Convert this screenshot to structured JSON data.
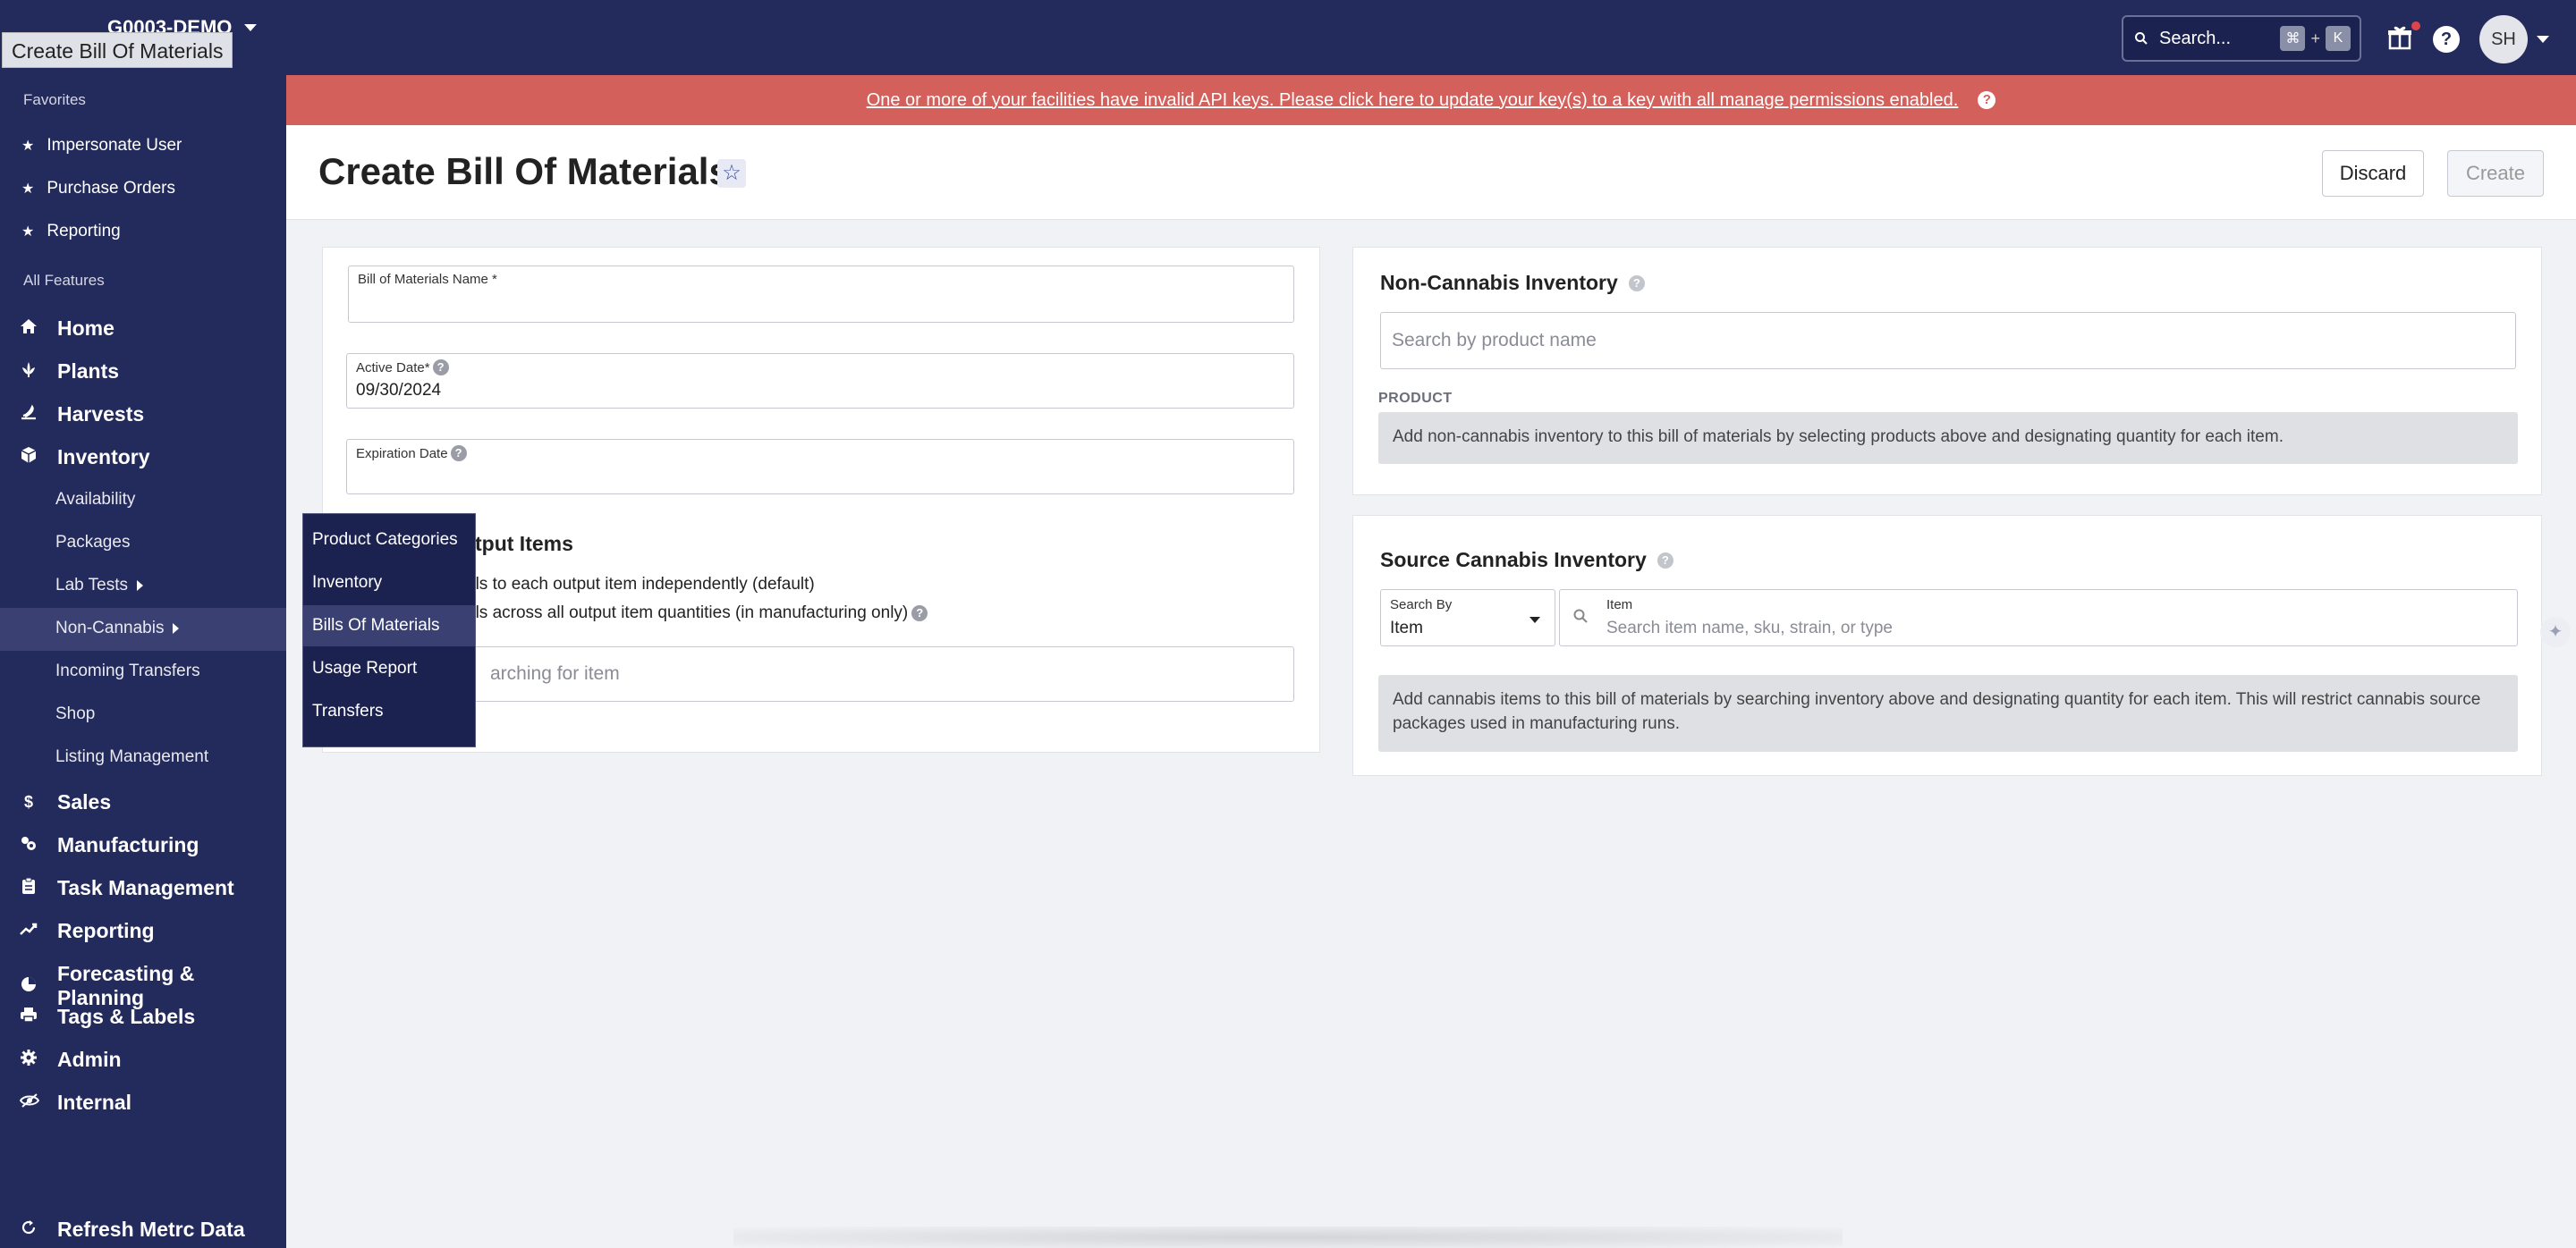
{
  "topbar": {
    "org_name": "G0003-DEMO",
    "search_placeholder": "Search...",
    "shortcut_key1": "⌘",
    "shortcut_plus": "+",
    "shortcut_key2": "K",
    "avatar_initials": "SH",
    "help_glyph": "?"
  },
  "window_title_tooltip": "Create Bill Of Materials",
  "sidebar": {
    "favorites_header": "Favorites",
    "favorites": [
      "Impersonate User",
      "Purchase Orders",
      "Reporting"
    ],
    "all_features_header": "All Features",
    "main_items": [
      {
        "label": "Home",
        "icon": "home-icon"
      },
      {
        "label": "Plants",
        "icon": "plant-icon"
      },
      {
        "label": "Harvests",
        "icon": "harvest-icon"
      },
      {
        "label": "Inventory",
        "icon": "inventory-icon"
      }
    ],
    "inventory_sub": [
      "Availability",
      "Packages",
      "Lab Tests",
      "Non-Cannabis",
      "Incoming Transfers",
      "Shop",
      "Listing Management"
    ],
    "lower_items": [
      {
        "label": "Sales",
        "icon": "dollar-icon"
      },
      {
        "label": "Manufacturing",
        "icon": "manufacturing-icon"
      },
      {
        "label": "Task Management",
        "icon": "clipboard-icon"
      },
      {
        "label": "Reporting",
        "icon": "chart-icon"
      },
      {
        "label": "Forecasting & Planning",
        "icon": "pie-icon"
      },
      {
        "label": "Tags & Labels",
        "icon": "printer-icon"
      },
      {
        "label": "Admin",
        "icon": "gear-icon"
      },
      {
        "label": "Internal",
        "icon": "eye-slash-icon"
      }
    ],
    "refresh_label": "Refresh Metrc Data"
  },
  "flyout": {
    "items": [
      "Product Categories",
      "Inventory",
      "Bills Of Materials",
      "Usage Report",
      "Transfers"
    ],
    "active_index": 2
  },
  "alert": {
    "message": "One or more of your facilities have invalid API keys. Please click here to update your key(s) to a key with all manage permissions enabled.",
    "help_glyph": "?"
  },
  "header": {
    "title": "Create Bill Of Materials",
    "star_glyph": "☆",
    "discard_label": "Discard",
    "create_label": "Create"
  },
  "form": {
    "name_label": "Bill of Materials Name *",
    "name_value": "",
    "active_date_label": "Active Date*",
    "active_date_value": "09/30/2024",
    "expiration_date_label": "Expiration Date",
    "expiration_date_value": "",
    "output_items_title_visible": "tput Items",
    "radio_option_1_visible": "als to each output item independently (default)",
    "radio_option_2_visible": "als across all output item quantities (in manufacturing only)",
    "output_search_visible": "arching for item"
  },
  "non_cannabis": {
    "title": "Non-Cannabis Inventory",
    "search_placeholder": "Search by product name",
    "product_header": "PRODUCT",
    "info": "Add non-cannabis inventory to this bill of materials by selecting products above and designating quantity for each item."
  },
  "source_cannabis": {
    "title": "Source Cannabis Inventory",
    "search_by_label": "Search By",
    "search_by_value": "Item",
    "item_label": "Item",
    "item_placeholder": "Search item name, sku, strain, or type",
    "info": "Add cannabis items to this bill of materials by searching inventory above and designating quantity for each item. This will restrict cannabis source packages used in manufacturing runs."
  },
  "colors": {
    "nav_bg": "#232a5c",
    "alert_bg": "#d3605a",
    "page_bg": "#f1f2f6"
  }
}
